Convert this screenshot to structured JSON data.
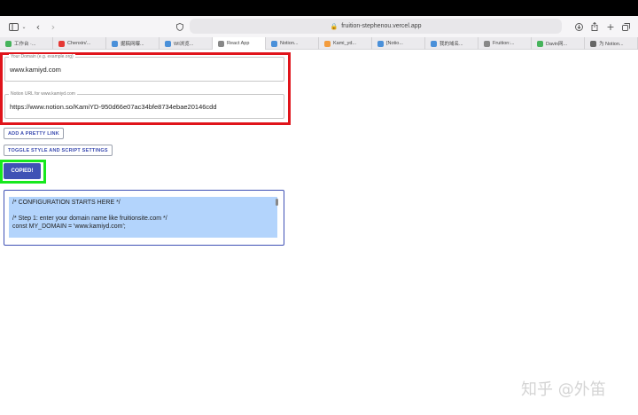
{
  "browser": {
    "url": "fruition-stephenou.vercel.app",
    "tabs": [
      {
        "label": "工作台 ·...",
        "color": "#46b35b",
        "active": false
      },
      {
        "label": "Chenxin/...",
        "color": "#e53935",
        "active": false
      },
      {
        "label": "掘稿网曝...",
        "color": "#4a90d9",
        "active": false
      },
      {
        "label": "WI浏览...",
        "color": "#4a90d9",
        "active": false
      },
      {
        "label": "React App",
        "color": "#888888",
        "active": true
      },
      {
        "label": "Notion...",
        "color": "#4a90d9",
        "active": false
      },
      {
        "label": "Kami_yd...",
        "color": "#f39c3d",
        "active": false
      },
      {
        "label": "[Notio...",
        "color": "#4a90d9",
        "active": false
      },
      {
        "label": "我的域名...",
        "color": "#4a90d9",
        "active": false
      },
      {
        "label": "Fruition:...",
        "color": "#888888",
        "active": false
      },
      {
        "label": "Davin网...",
        "color": "#46b35b",
        "active": false
      },
      {
        "label": "为 Notion...",
        "color": "#666666",
        "active": false
      }
    ]
  },
  "form": {
    "domain_label": "Your Domain (e.g. example.org)",
    "domain_value": "www.kamiyd.com",
    "notion_label": "Notion URL for www.kamiyd.com",
    "notion_value": "https://www.notion.so/KamiYD-950d66e07ac34bfe8734ebae20146cdd"
  },
  "buttons": {
    "add_link": "ADD A PRETTY LINK",
    "toggle": "TOGGLE STYLE AND SCRIPT SETTINGS",
    "copied": "COPIED!"
  },
  "code": {
    "text": "/* CONFIGURATION STARTS HERE */\n\n/* Step 1: enter your domain name like fruitionsite.com */\nconst MY_DOMAIN = 'www.kamiyd.com';"
  },
  "watermark": "知乎 @外笛"
}
